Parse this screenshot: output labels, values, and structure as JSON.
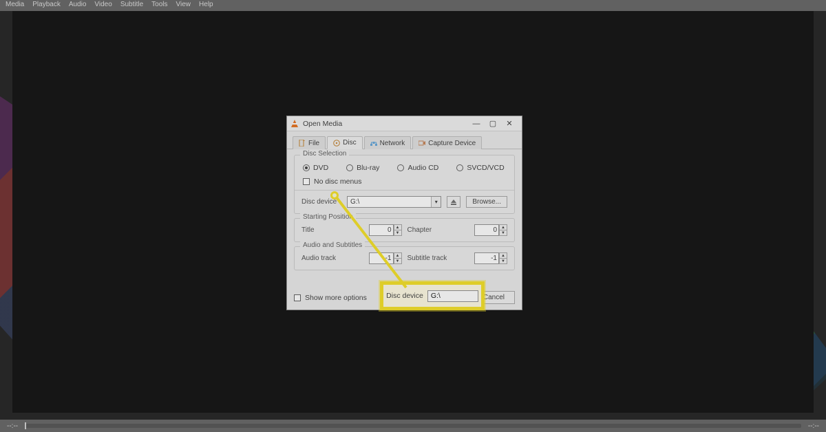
{
  "menu": {
    "items": [
      "Media",
      "Playback",
      "Audio",
      "Video",
      "Subtitle",
      "Tools",
      "View",
      "Help"
    ]
  },
  "times": {
    "left": "--:--",
    "right": "--:--"
  },
  "dialog": {
    "title": "Open Media",
    "tabs": {
      "file": "File",
      "disc": "Disc",
      "network": "Network",
      "capture": "Capture Device"
    },
    "disc": {
      "legend": "Disc Selection",
      "options": {
        "dvd": "DVD",
        "bluray": "Blu-ray",
        "audiocd": "Audio CD",
        "svcd": "SVCD/VCD"
      },
      "no_menus": "No disc menus",
      "device_label": "Disc device",
      "device_value": "G:\\",
      "browse": "Browse..."
    },
    "start": {
      "legend": "Starting Position",
      "title_label": "Title",
      "title_value": "0",
      "chapter_label": "Chapter",
      "chapter_value": "0"
    },
    "audio": {
      "legend": "Audio and Subtitles",
      "audio_label": "Audio track",
      "audio_value": "-1",
      "sub_label": "Subtitle track",
      "sub_value": "-1"
    },
    "more_options": "Show more options",
    "cancel": "Cancel"
  },
  "callout": {
    "label": "Disc device",
    "value": "G:\\"
  }
}
